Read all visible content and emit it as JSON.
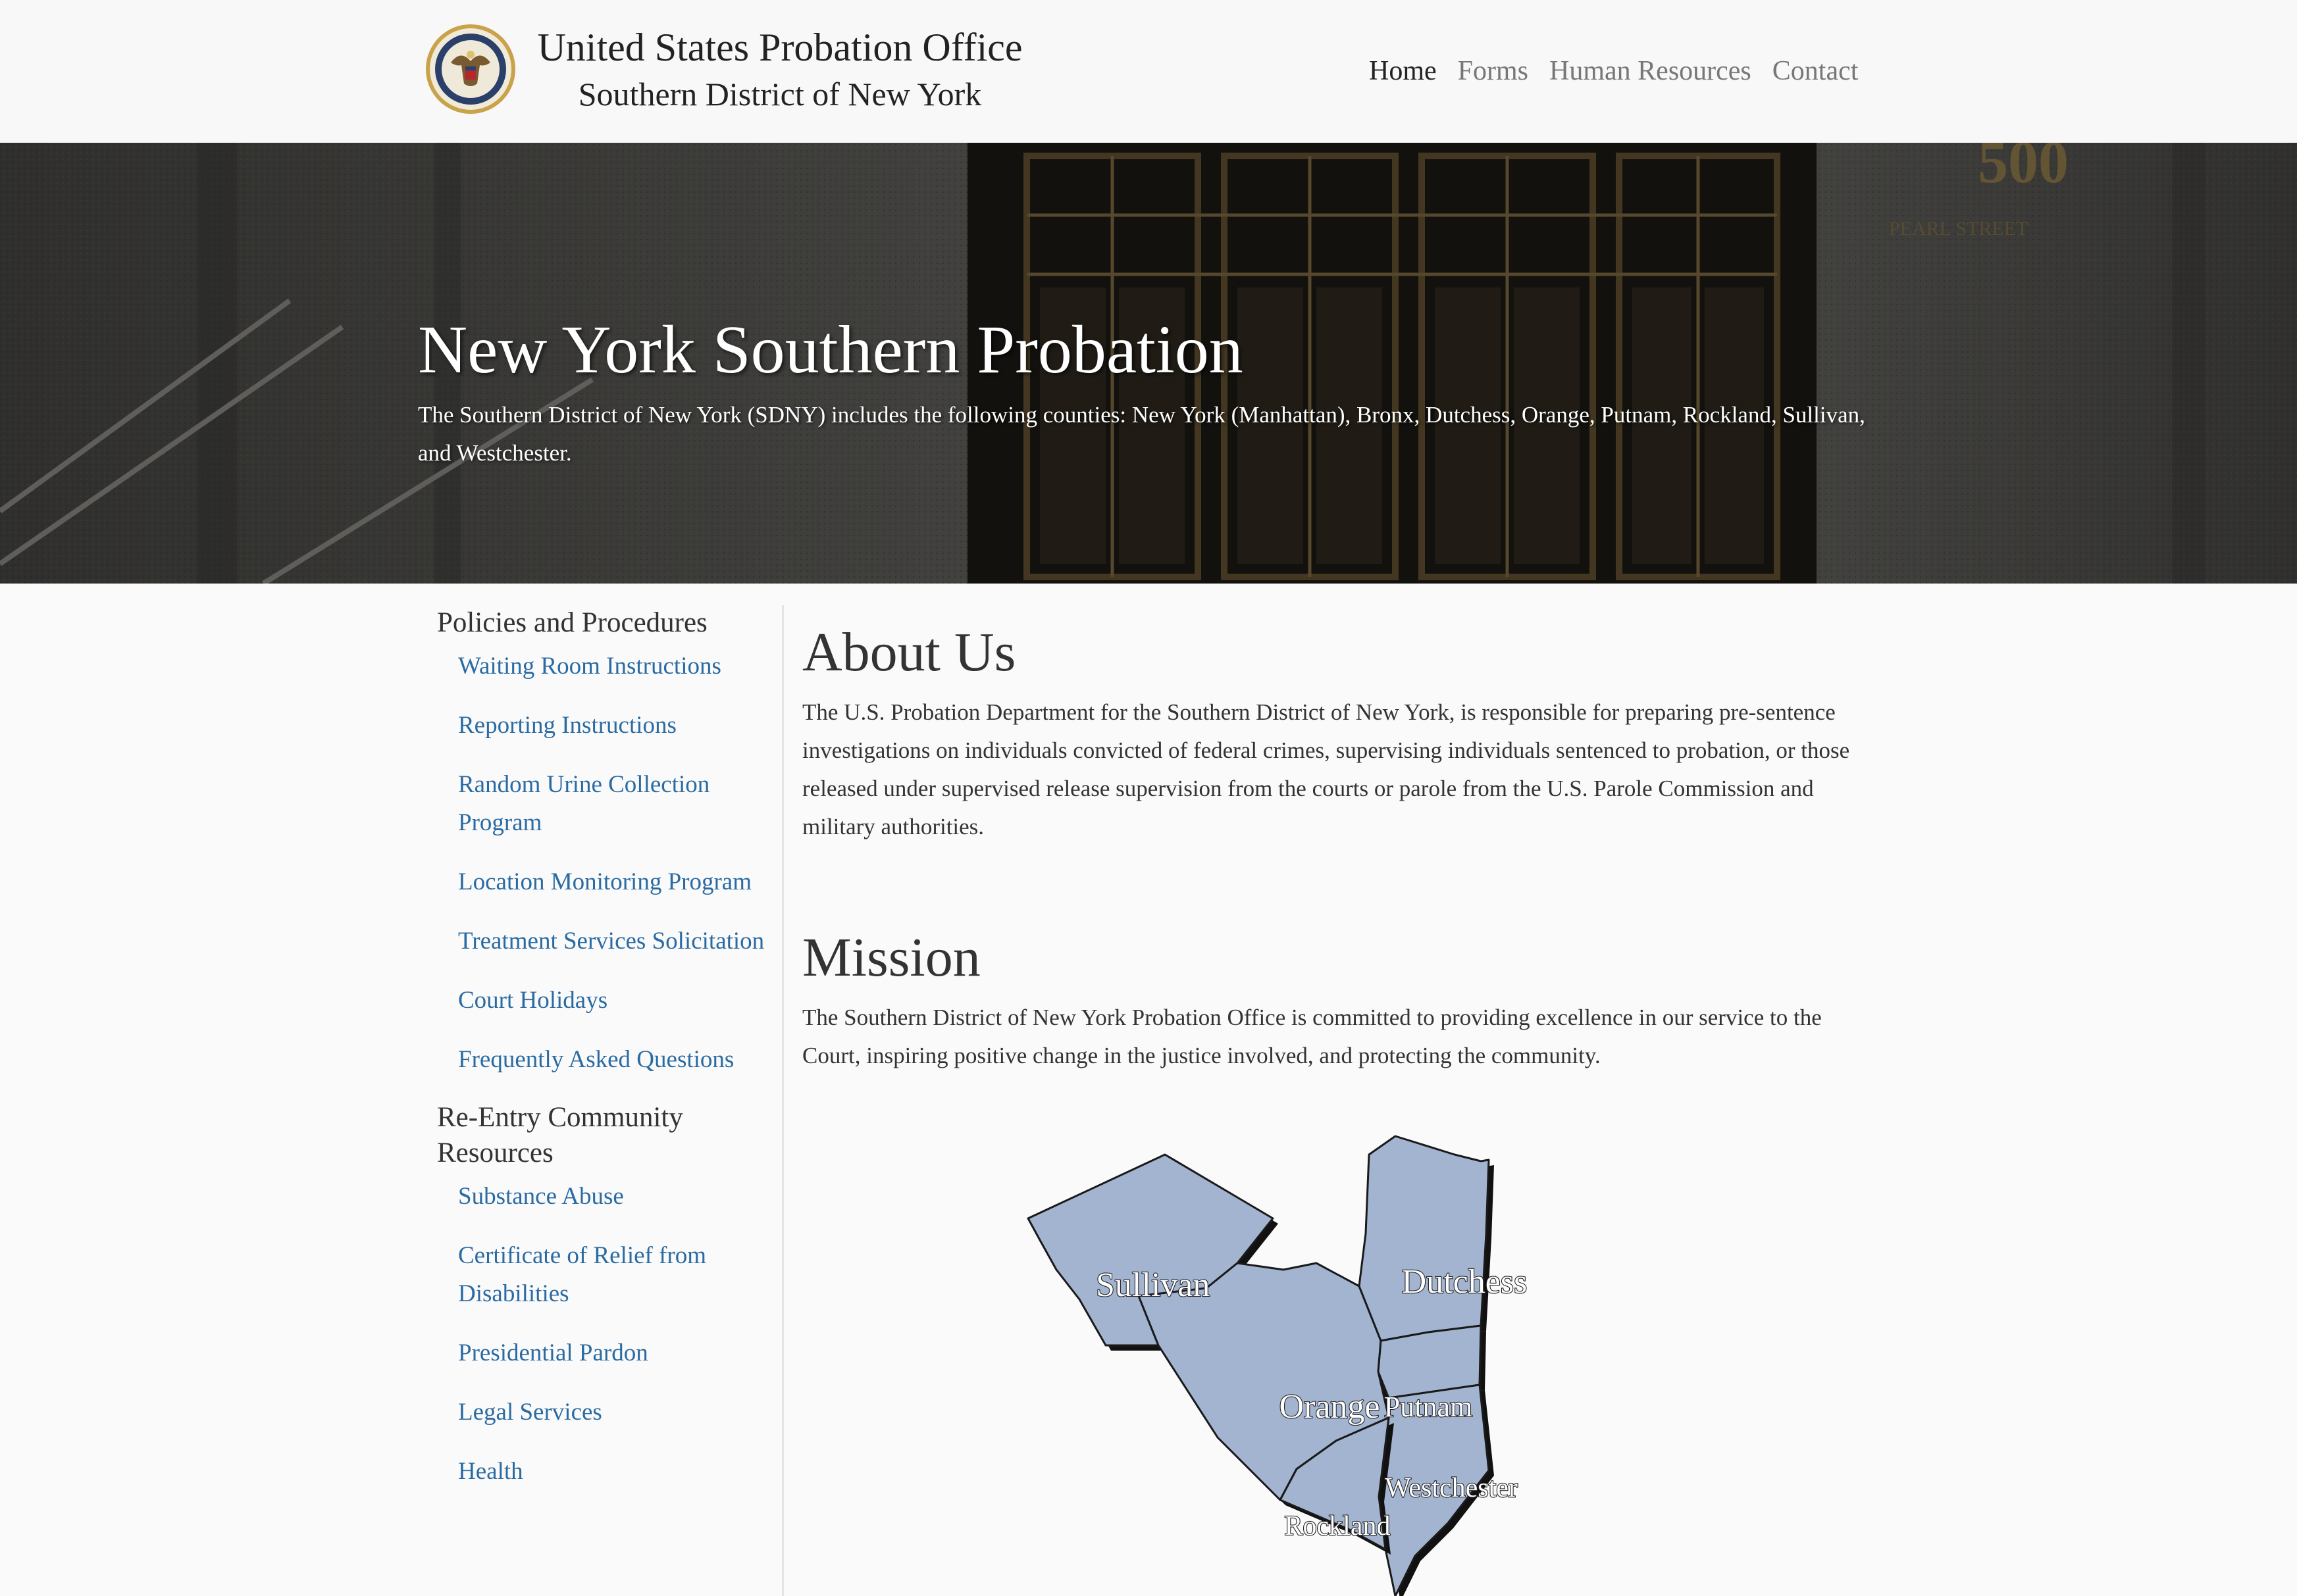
{
  "header": {
    "title_line1": "United States Probation Office",
    "title_line2": "Southern District of New York",
    "nav": [
      "Home",
      "Forms",
      "Human Resources",
      "Contact"
    ]
  },
  "hero": {
    "title": "New York Southern Probation",
    "subtitle": "The Southern District of New York (SDNY) includes the following counties: New York (Manhattan), Bronx, Dutchess, Orange, Putnam, Rockland, Sullivan, and Westchester.",
    "building_number": "500",
    "street_text": "PEARL STREET"
  },
  "sidebar": {
    "section1": {
      "heading": "Policies and Procedures",
      "links": [
        "Waiting Room Instructions",
        "Reporting Instructions",
        "Random Urine Collection Program",
        "Location Monitoring Program",
        "Treatment Services Solicitation",
        "Court Holidays",
        "Frequently Asked Questions"
      ]
    },
    "section2": {
      "heading": "Re-Entry Community Resources",
      "links": [
        "Substance Abuse",
        "Certificate of Relief from Disabilities",
        "Presidential Pardon",
        "Legal Services",
        "Health"
      ]
    }
  },
  "main": {
    "about_heading": "About Us",
    "about_text": "The U.S. Probation Department for the Southern District of New York, is responsible for preparing pre-sentence investigations on individuals convicted of federal crimes, supervising individuals sentenced to probation, or those released under supervised release supervision from the courts or parole from the U.S. Parole Commission and military authorities.",
    "mission_heading": "Mission",
    "mission_text": "The Southern District of New York Probation Office is committed to providing excellence in our service to the Court, inspiring positive change in the justice involved, and protecting the community."
  },
  "map": {
    "counties": [
      "Sullivan",
      "Dutchess",
      "Orange",
      "Putnam",
      "Westchester",
      "Rockland"
    ],
    "fill_color": "#a2b4d0"
  },
  "colors": {
    "link": "#2a6ba3",
    "background": "#fafafa",
    "header_bg": "#f8f8f8"
  }
}
